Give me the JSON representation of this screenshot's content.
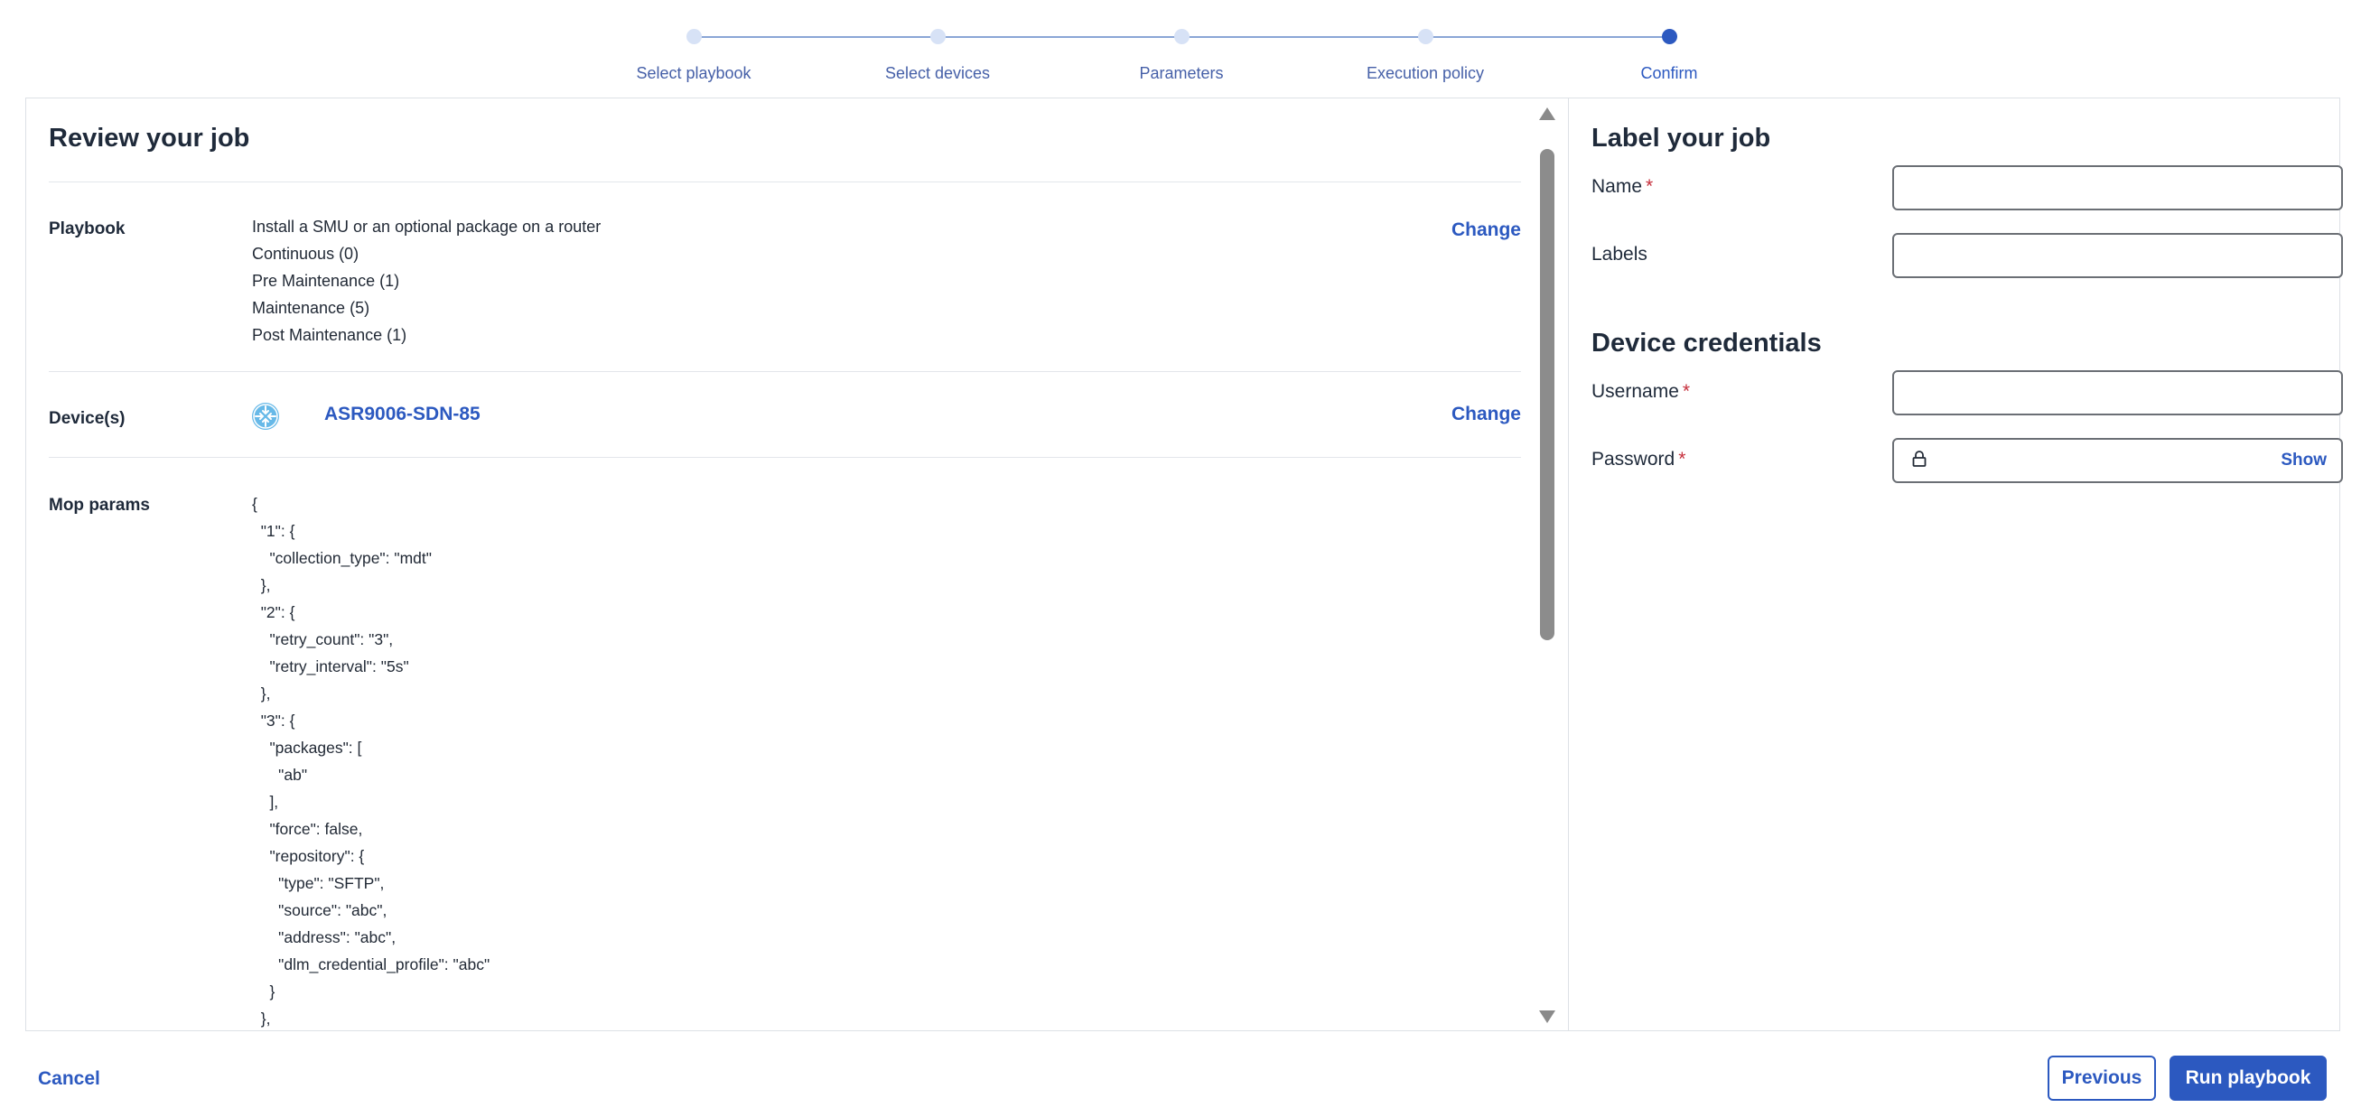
{
  "stepper": {
    "steps": [
      {
        "label": "Select playbook",
        "state": "done"
      },
      {
        "label": "Select devices",
        "state": "done"
      },
      {
        "label": "Parameters",
        "state": "done"
      },
      {
        "label": "Execution policy",
        "state": "done"
      },
      {
        "label": "Confirm",
        "state": "active"
      }
    ]
  },
  "review": {
    "title": "Review your job",
    "playbook": {
      "label": "Playbook",
      "lines": [
        "Install a SMU or an optional package on a router",
        "Continuous (0)",
        "Pre Maintenance (1)",
        "Maintenance (5)",
        "Post Maintenance (1)"
      ],
      "change_label": "Change"
    },
    "devices": {
      "label": "Device(s)",
      "device_name": "ASR9006-SDN-85",
      "change_label": "Change"
    },
    "mop_params": {
      "label": "Mop params",
      "lines": [
        "{",
        "  \"1\": {",
        "    \"collection_type\": \"mdt\"",
        "  },",
        "  \"2\": {",
        "    \"retry_count\": \"3\",",
        "    \"retry_interval\": \"5s\"",
        "  },",
        "  \"3\": {",
        "    \"packages\": [",
        "      \"ab\"",
        "    ],",
        "    \"force\": false,",
        "    \"repository\": {",
        "      \"type\": \"SFTP\",",
        "      \"source\": \"abc\",",
        "      \"address\": \"abc\",",
        "      \"dlm_credential_profile\": \"abc\"",
        "    }",
        "  },"
      ]
    }
  },
  "label_job": {
    "title": "Label your job",
    "name_label": "Name",
    "name_value": "",
    "labels_label": "Labels",
    "labels_value": ""
  },
  "credentials": {
    "title": "Device credentials",
    "username_label": "Username",
    "username_value": "",
    "password_label": "Password",
    "password_value": "",
    "show_label": "Show",
    "required_marker": "*"
  },
  "footer": {
    "cancel_label": "Cancel",
    "previous_label": "Previous",
    "run_label": "Run playbook"
  },
  "colors": {
    "accent": "#2c59c0",
    "required": "#c62f3c",
    "device_icon": "#67b9e8"
  }
}
